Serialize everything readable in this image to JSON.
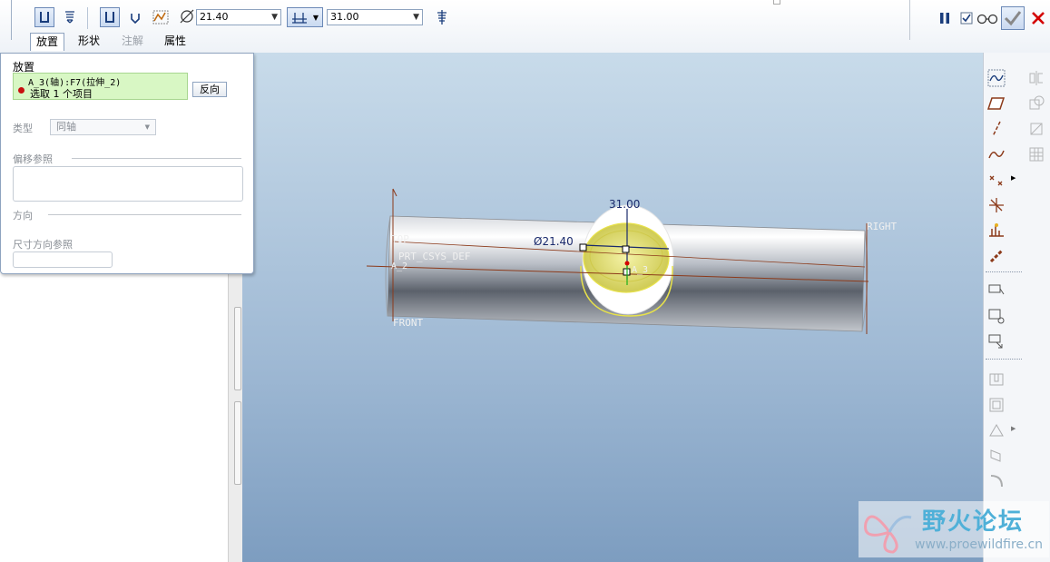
{
  "dashboard": {
    "diameter_value": "21.40",
    "depth_value": "31.00",
    "tabs": [
      {
        "label": "放置",
        "state": "active"
      },
      {
        "label": "形状",
        "state": "normal"
      },
      {
        "label": "注解",
        "state": "disabled"
      },
      {
        "label": "属性",
        "state": "normal"
      }
    ]
  },
  "panel": {
    "title": "放置",
    "primary_ref": "A_3(轴):F7(拉伸_2)",
    "secondary_ref": "选取 1 个项目",
    "flip_button": "反向",
    "type_label": "类型",
    "type_value": "同轴",
    "offset_label": "偏移参照",
    "direction_label": "方向",
    "dim_dir_label": "尺寸方向参照"
  },
  "viewport": {
    "label_top": "TOP",
    "label_csys": "PRT_CSYS_DEF",
    "label_right": "RIGHT",
    "label_front": "FRONT",
    "label_axis": "A_3",
    "label_a2": "A_2",
    "dim_depth": "31.00",
    "dim_diameter": "21.40"
  },
  "watermark": {
    "brand": "野火论坛",
    "url": "www.proewildfire.cn"
  },
  "colors": {
    "selection_green": "#d8f7c4",
    "accent_blue": "#1a3d7c",
    "close_red": "#d40000",
    "datum_brown": "#8c3a1a",
    "hole_yellow": "#e8e24a"
  }
}
